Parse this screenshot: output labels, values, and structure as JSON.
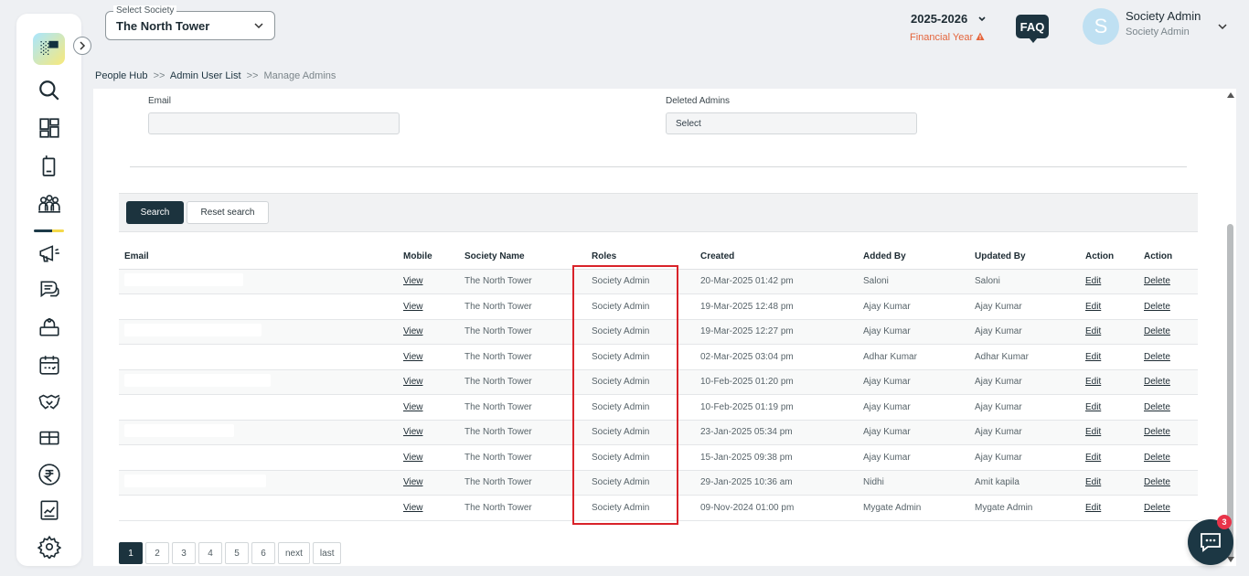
{
  "header": {
    "society_select_label": "Select Society",
    "society_select_value": "The North Tower",
    "financial_year": "2025-2026",
    "financial_year_label": "Financial Year",
    "faq_label": "FAQ",
    "avatar_initial": "S",
    "user_name": "Society Admin",
    "user_role": "Society Admin"
  },
  "breadcrumb": {
    "items": [
      "People Hub",
      "Admin User List",
      "Manage Admins"
    ],
    "separator": ">>"
  },
  "filters": {
    "email_label": "Email",
    "email_value": "",
    "deleted_admins_label": "Deleted Admins",
    "deleted_admins_value": "Select"
  },
  "actions": {
    "search_label": "Search",
    "reset_label": "Reset search"
  },
  "table": {
    "columns": [
      "Email",
      "Mobile",
      "Society Name",
      "Roles",
      "Created",
      "Added By",
      "Updated By",
      "Action",
      "Action"
    ],
    "rows": [
      {
        "mobile": "View",
        "society": "The North Tower",
        "role": "Society Admin",
        "created": "20-Mar-2025 01:42 pm",
        "added_by": "Saloni",
        "updated_by": "Saloni",
        "edit": "Edit",
        "delete": "Delete"
      },
      {
        "mobile": "View",
        "society": "The North Tower",
        "role": "Society Admin",
        "created": "19-Mar-2025 12:48 pm",
        "added_by": "Ajay Kumar",
        "updated_by": "Ajay Kumar",
        "edit": "Edit",
        "delete": "Delete"
      },
      {
        "mobile": "View",
        "society": "The North Tower",
        "role": "Society Admin",
        "created": "19-Mar-2025 12:27 pm",
        "added_by": "Ajay Kumar",
        "updated_by": "Ajay Kumar",
        "edit": "Edit",
        "delete": "Delete"
      },
      {
        "mobile": "View",
        "society": "The North Tower",
        "role": "Society Admin",
        "created": "02-Mar-2025 03:04 pm",
        "added_by": "Adhar Kumar",
        "updated_by": "Adhar Kumar",
        "edit": "Edit",
        "delete": "Delete"
      },
      {
        "mobile": "View",
        "society": "The North Tower",
        "role": "Society Admin",
        "created": "10-Feb-2025 01:20 pm",
        "added_by": "Ajay Kumar",
        "updated_by": "Ajay Kumar",
        "edit": "Edit",
        "delete": "Delete"
      },
      {
        "mobile": "View",
        "society": "The North Tower",
        "role": "Society Admin",
        "created": "10-Feb-2025 01:19 pm",
        "added_by": "Ajay Kumar",
        "updated_by": "Ajay Kumar",
        "edit": "Edit",
        "delete": "Delete"
      },
      {
        "mobile": "View",
        "society": "The North Tower",
        "role": "Society Admin",
        "created": "23-Jan-2025 05:34 pm",
        "added_by": "Ajay Kumar",
        "updated_by": "Ajay Kumar",
        "edit": "Edit",
        "delete": "Delete"
      },
      {
        "mobile": "View",
        "society": "The North Tower",
        "role": "Society Admin",
        "created": "15-Jan-2025 09:38 pm",
        "added_by": "Ajay Kumar",
        "updated_by": "Ajay Kumar",
        "edit": "Edit",
        "delete": "Delete"
      },
      {
        "mobile": "View",
        "society": "The North Tower",
        "role": "Society Admin",
        "created": "29-Jan-2025 10:36 am",
        "added_by": "Nidhi",
        "updated_by": "Amit kapila",
        "edit": "Edit",
        "delete": "Delete"
      },
      {
        "mobile": "View",
        "society": "The North Tower",
        "role": "Society Admin",
        "created": "09-Nov-2024 01:00 pm",
        "added_by": "Mygate Admin",
        "updated_by": "Mygate Admin",
        "edit": "Edit",
        "delete": "Delete"
      }
    ]
  },
  "pagination": {
    "pages": [
      "1",
      "2",
      "3",
      "4",
      "5",
      "6"
    ],
    "next_label": "next",
    "last_label": "last",
    "current": "1"
  },
  "chat": {
    "badge_count": "3"
  },
  "colors": {
    "primary_dark": "#1c333e",
    "warning": "#e4643b",
    "highlight_box": "#d9232a",
    "badge": "#e8344a"
  },
  "sidebar_icons": [
    "search-icon",
    "dashboard-icon",
    "mobile-icon",
    "people-icon",
    "megaphone-icon",
    "chat-icon",
    "helpdesk-icon",
    "calendar-icon",
    "handshake-icon",
    "amenity-icon",
    "rupee-icon",
    "report-icon",
    "settings-icon"
  ]
}
